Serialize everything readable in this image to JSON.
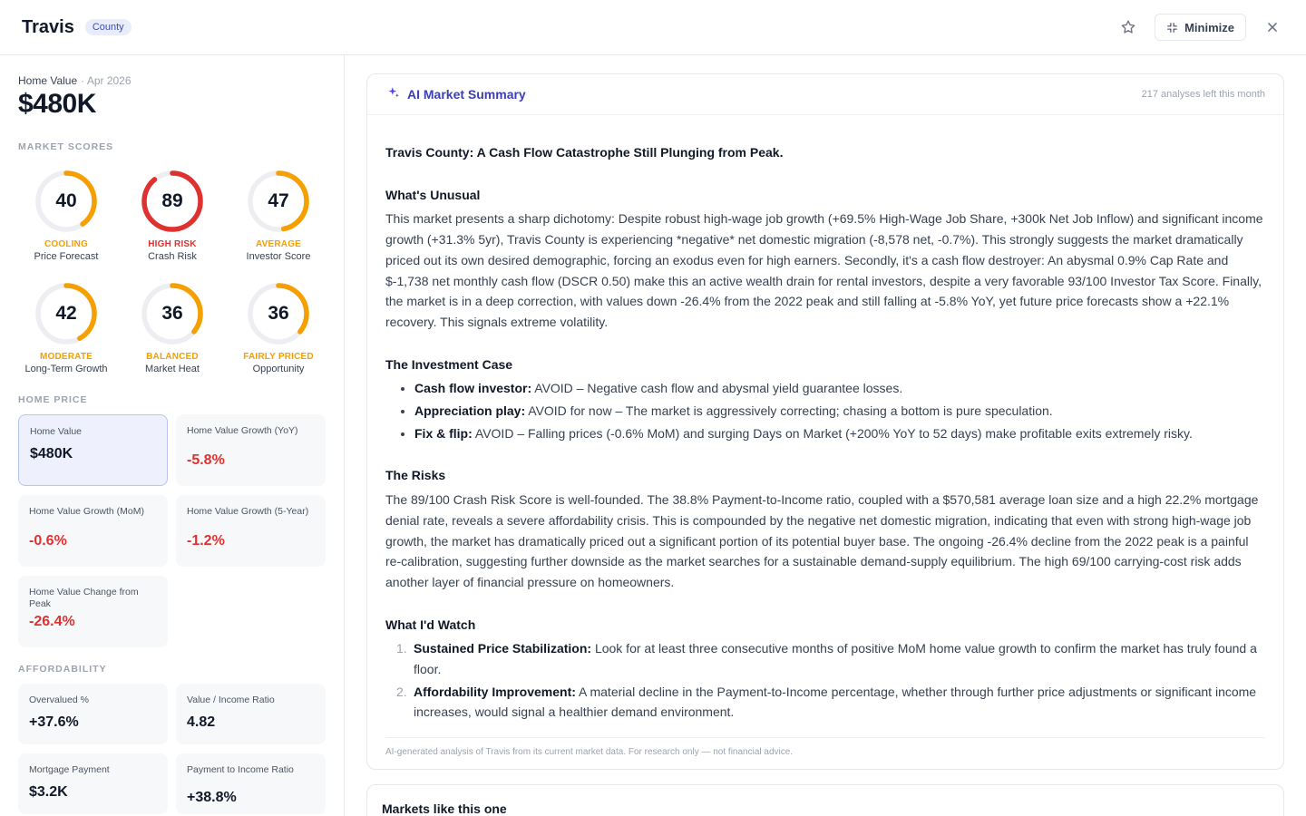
{
  "header": {
    "title": "Travis",
    "badge": "County",
    "minimize_label": "Minimize"
  },
  "home_value": {
    "label": "Home Value",
    "date": "· Apr 2026",
    "value": "$480K"
  },
  "market_scores": {
    "title": "Market Scores",
    "items": [
      {
        "score": 40,
        "status": "COOLING",
        "name": "Price Forecast",
        "color": "#f59f00"
      },
      {
        "score": 89,
        "status": "HIGH RISK",
        "name": "Crash Risk",
        "color": "#e03131"
      },
      {
        "score": 47,
        "status": "AVERAGE",
        "name": "Investor Score",
        "color": "#f59f00"
      },
      {
        "score": 42,
        "status": "MODERATE",
        "name": "Long-Term Growth",
        "color": "#f59f00"
      },
      {
        "score": 36,
        "status": "BALANCED",
        "name": "Market Heat",
        "color": "#f59f00"
      },
      {
        "score": 36,
        "status": "FAIRLY PRICED",
        "name": "Opportunity",
        "color": "#f59f00"
      }
    ]
  },
  "home_price": {
    "title": "Home Price",
    "cards": [
      {
        "label": "Home Value",
        "value": "$480K"
      },
      {
        "label": "Home Value Growth (YoY)",
        "value": "-5.8%"
      },
      {
        "label": "Home Value Growth (MoM)",
        "value": "-0.6%"
      },
      {
        "label": "Home Value Growth (5-Year)",
        "value": "-1.2%"
      },
      {
        "label": "Home Value Change from Peak",
        "value": "-26.4%"
      }
    ]
  },
  "affordability": {
    "title": "Affordability",
    "cards": [
      {
        "label": "Overvalued %",
        "value": "+37.6%"
      },
      {
        "label": "Value / Income Ratio",
        "value": "4.82"
      },
      {
        "label": "Mortgage Payment",
        "value": "$3.2K"
      },
      {
        "label": "Payment to Income Ratio",
        "value": "+38.8%"
      }
    ]
  },
  "ai_summary": {
    "title": "AI Market Summary",
    "analyses_left": "217 analyses left this month",
    "headline": "Travis County: A Cash Flow Catastrophe Still Plunging from Peak.",
    "unusual_title": "What's Unusual",
    "unusual_text": "This market presents a sharp dichotomy: Despite robust high-wage job growth (+69.5% High-Wage Job Share, +300k Net Job Inflow) and significant income growth (+31.3% 5yr), Travis County is experiencing *negative* net domestic migration (-8,578 net, -0.7%). This strongly suggests the market dramatically priced out its own desired demographic, forcing an exodus even for high earners. Secondly, it's a cash flow destroyer: An abysmal 0.9% Cap Rate and $-1,738 net monthly cash flow (DSCR 0.50) make this an active wealth drain for rental investors, despite a very favorable 93/100 Investor Tax Score. Finally, the market is in a deep correction, with values down -26.4% from the 2022 peak and still falling at -5.8% YoY, yet future price forecasts show a +22.1% recovery. This signals extreme volatility.",
    "case_title": "The Investment Case",
    "case_items": [
      {
        "label": "Cash flow investor:",
        "text": "AVOID – Negative cash flow and abysmal yield guarantee losses."
      },
      {
        "label": "Appreciation play:",
        "text": "AVOID for now – The market is aggressively correcting; chasing a bottom is pure speculation."
      },
      {
        "label": "Fix & flip:",
        "text": "AVOID – Falling prices (-0.6% MoM) and surging Days on Market (+200% YoY to 52 days) make profitable exits extremely risky."
      }
    ],
    "risks_title": "The Risks",
    "risks_text": "The 89/100 Crash Risk Score is well-founded. The 38.8% Payment-to-Income ratio, coupled with a $570,581 average loan size and a high 22.2% mortgage denial rate, reveals a severe affordability crisis. This is compounded by the negative net domestic migration, indicating that even with strong high-wage job growth, the market has dramatically priced out a significant portion of its potential buyer base. The ongoing -26.4% decline from the 2022 peak is a painful re-calibration, suggesting further downside as the market searches for a sustainable demand-supply equilibrium. The high 69/100 carrying-cost risk adds another layer of financial pressure on homeowners.",
    "watch_title": "What I'd Watch",
    "watch_items": [
      {
        "num": "1.",
        "label": "Sustained Price Stabilization:",
        "text": "Look for at least three consecutive months of positive MoM home value growth to confirm the market has truly found a floor."
      },
      {
        "num": "2.",
        "label": "Affordability Improvement:",
        "text": "A material decline in the Payment-to-Income percentage, whether through further price adjustments or significant income increases, would signal a healthier demand environment."
      }
    ],
    "disclaimer": "AI-generated analysis of Travis from its current market data. For research only — not financial advice."
  },
  "similar_markets": {
    "title": "Markets like this one"
  }
}
